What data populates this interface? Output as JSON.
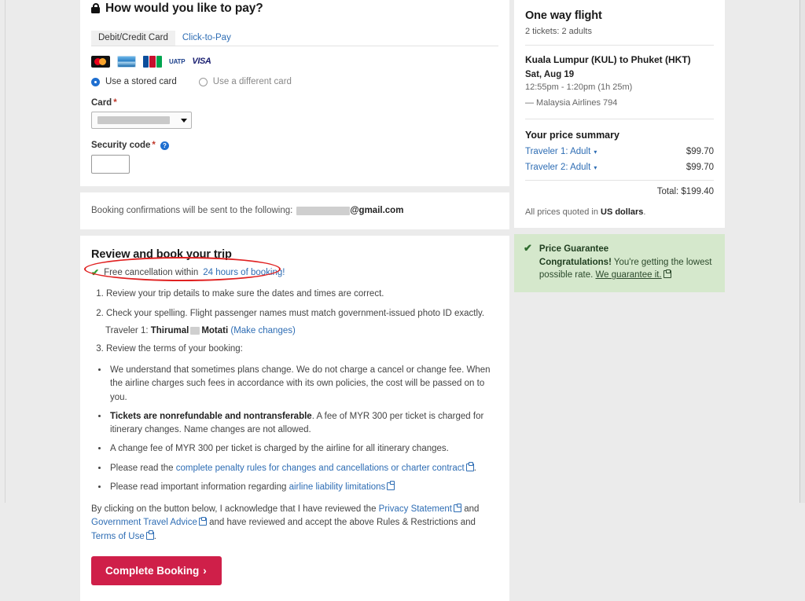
{
  "payment": {
    "heading": "How would you like to pay?",
    "lock_icon": "lock-icon",
    "tabs": [
      {
        "label": "Debit/Credit Card",
        "active": true
      },
      {
        "label": "Click-to-Pay",
        "active": false
      }
    ],
    "card_logos": [
      "mastercard",
      "american-express",
      "jcb",
      "uatp",
      "visa"
    ],
    "uatp_text": "UATP",
    "visa_text": "VISA",
    "radio_stored": "Use a stored card",
    "radio_different": "Use a different card",
    "card_label": "Card",
    "required_mark": "*",
    "card_value": "",
    "security_label": "Security code",
    "security_value": "",
    "help_glyph": "?"
  },
  "email_confirm": {
    "text": "Booking confirmations will be sent to the following:",
    "domain": "@gmail.com"
  },
  "review": {
    "title": "Review and book your trip",
    "free_cancellation_prefix": "Free cancellation within",
    "free_cancellation_link": "24 hours of booking!",
    "steps": [
      "Review your trip details to make sure the dates and times are correct.",
      "Check your spelling. Flight passenger names must match government-issued photo ID exactly.",
      "Review the terms of your booking:"
    ],
    "traveler_prefix": "Traveler 1:",
    "traveler_first": "Thirumal",
    "traveler_last": "Motati",
    "traveler_link": "(Make changes)",
    "terms": [
      {
        "bold": "",
        "text": "We understand that sometimes plans change. We do not charge a cancel or change fee. When the airline charges such fees in accordance with its own policies, the cost will be passed on to you."
      },
      {
        "bold": "Tickets are nonrefundable and nontransferable",
        "text": ". A fee of MYR 300 per ticket is charged for itinerary changes. Name changes are not allowed."
      },
      {
        "bold": "",
        "text": "A change fee of MYR 300 per ticket is charged by the airline for all itinerary changes."
      },
      {
        "bold": "",
        "text": "Please read the ",
        "link": "complete penalty rules for changes and cancellations or charter contract",
        "suffix": "."
      },
      {
        "bold": "",
        "text": "Please read important information regarding ",
        "link": "airline liability limitations",
        "suffix": ""
      }
    ],
    "ack_part1": "By clicking on the button below, I acknowledge that I have reviewed the ",
    "ack_link1": "Privacy Statement",
    "ack_part2": " and ",
    "ack_link2": "Government Travel Advice",
    "ack_part3": " and have reviewed and accept the above Rules & Restrictions and ",
    "ack_link3": "Terms of Use",
    "ack_part4": ".",
    "complete_button": "Complete Booking",
    "complete_button_arrow": "›"
  },
  "flight": {
    "title": "One way flight",
    "tickets": "2 tickets: 2 adults",
    "route": "Kuala Lumpur (KUL) to Phuket (HKT)",
    "date": "Sat, Aug 19",
    "times": "12:55pm - 1:20pm (1h 25m)",
    "airline": "— Malaysia Airlines 794"
  },
  "price_summary": {
    "title": "Your price summary",
    "rows": [
      {
        "label": "Traveler 1: Adult",
        "amount": "$99.70"
      },
      {
        "label": "Traveler 2: Adult",
        "amount": "$99.70"
      }
    ],
    "caret_glyph": "▾",
    "total": "Total: $199.40",
    "currency_prefix": "All prices quoted in ",
    "currency_bold": "US dollars",
    "currency_suffix": "."
  },
  "guarantee": {
    "check_glyph": "✔",
    "title": "Price Guarantee",
    "congrats": "Congratulations!",
    "body": " You're getting the lowest possible rate. ",
    "link": "We guarantee it."
  },
  "colors": {
    "accent_red": "#cf1f49",
    "link_blue": "#2e6db4",
    "annotation_red": "#e02020",
    "guarantee_green_bg": "#d5e8cc",
    "page_bg": "#ebebeb"
  }
}
